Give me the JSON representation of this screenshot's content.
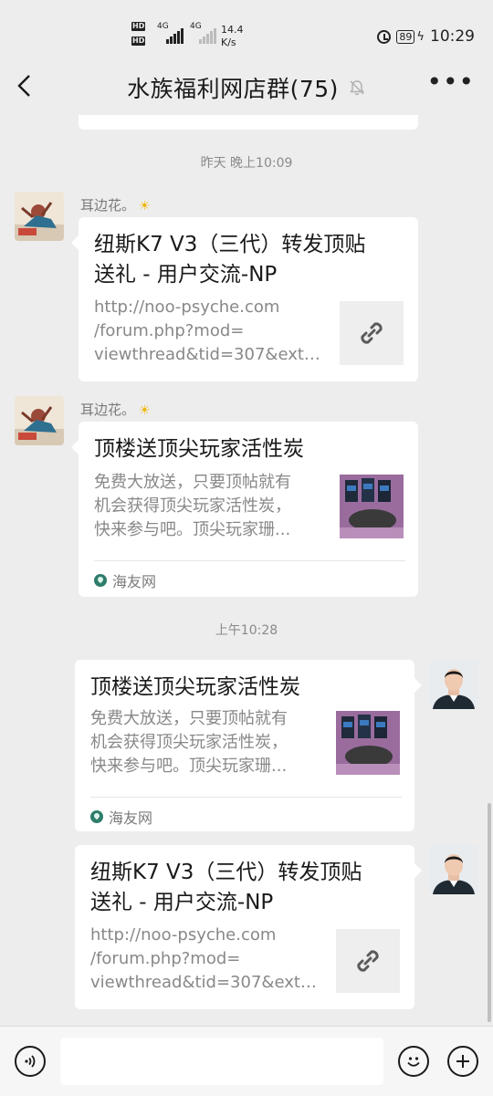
{
  "status_bar": {
    "net_speed_value": "14.4",
    "net_speed_unit": "K/s",
    "network_label": "4G",
    "battery": "89",
    "time": "10:29"
  },
  "header": {
    "title": "水族福利网店群(75)"
  },
  "messages": [
    {
      "timestamp": "昨天 晚上10:09",
      "sender": "耳边花。",
      "card_title": "纽斯K7 V3（三代）转发顶贴送礼 - 用户交流-NP",
      "card_desc": "http://noo-psyche.com/forum.php?mod=viewthread&tid=307&extr..."
    },
    {
      "sender": "耳边花。",
      "card_title": "顶楼送顶尖玩家活性炭",
      "card_desc": "免费大放送，只要顶帖就有机会获得顶尖玩家活性炭，快来参与吧。顶尖玩家珊...",
      "source": "海友网"
    },
    {
      "timestamp": "上午10:28",
      "card_title": "顶楼送顶尖玩家活性炭",
      "card_desc": "免费大放送，只要顶帖就有机会获得顶尖玩家活性炭，快来参与吧。顶尖玩家珊...",
      "source": "海友网"
    },
    {
      "card_title": "纽斯K7 V3（三代）转发顶贴送礼 - 用户交流-NP",
      "card_desc": "http://noo-psyche.com/forum.php?mod=viewthread&tid=307&extr..."
    }
  ],
  "desc_lines": {
    "url": [
      "http://noo-psyche.com",
      "/forum.php?mod=",
      "viewthread&tid=307&extr..."
    ],
    "promo": [
      "免费大放送，只要顶帖就有",
      "机会获得顶尖玩家活性炭，",
      "快来参与吧。顶尖玩家珊..."
    ]
  },
  "title_lines": {
    "k7": [
      "纽斯K7 V3（三代）转发顶贴",
      "送礼 - 用户交流-NP"
    ]
  },
  "input_bar": {
    "input_value": ""
  },
  "colors": {
    "background": "#ededed",
    "bubble": "#ffffff",
    "source_icon": "#2e7d6b"
  }
}
